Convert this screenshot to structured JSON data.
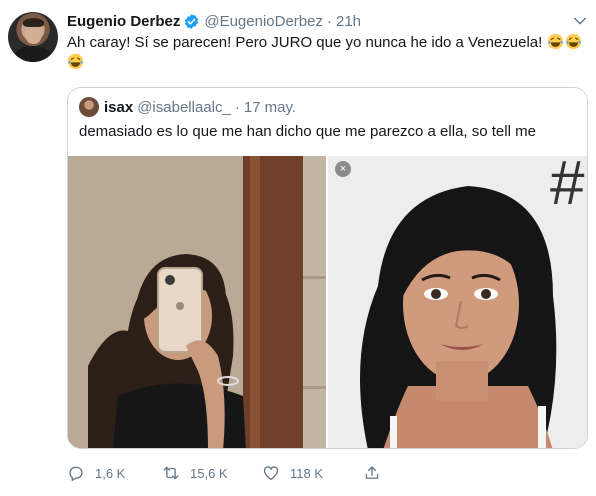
{
  "tweet": {
    "author_name": "Eugenio Derbez",
    "author_handle": "@EugenioDerbez",
    "separator": "·",
    "time": "21h",
    "text": "Ah caray! Sí se parecen! Pero JURO que yo nunca he ido a Venezuela!",
    "emoji": [
      "face-with-tears-of-joy",
      "face-with-tears-of-joy",
      "face-with-tears-of-joy"
    ]
  },
  "quote": {
    "author_name": "isax",
    "author_handle": "@isabellaalc_",
    "separator": "·",
    "date": "17 may.",
    "text": "demasiado es lo que me han dicho que me parezco a ella, so tell me",
    "media": [
      {
        "icon": "mirror-selfie-photo"
      },
      {
        "icon": "portrait-photo",
        "badge": "×",
        "watermark": "#"
      }
    ]
  },
  "actions": {
    "reply_count": "1,6 K",
    "retweet_count": "15,6 K",
    "like_count": "118 K"
  },
  "colors": {
    "text": "#14171a",
    "secondary": "#657786",
    "verified": "#1da1f2",
    "border": "#ccd6dd"
  },
  "icons": [
    "verified-badge-icon",
    "chevron-down-icon",
    "reply-icon",
    "retweet-icon",
    "like-icon",
    "share-icon"
  ]
}
